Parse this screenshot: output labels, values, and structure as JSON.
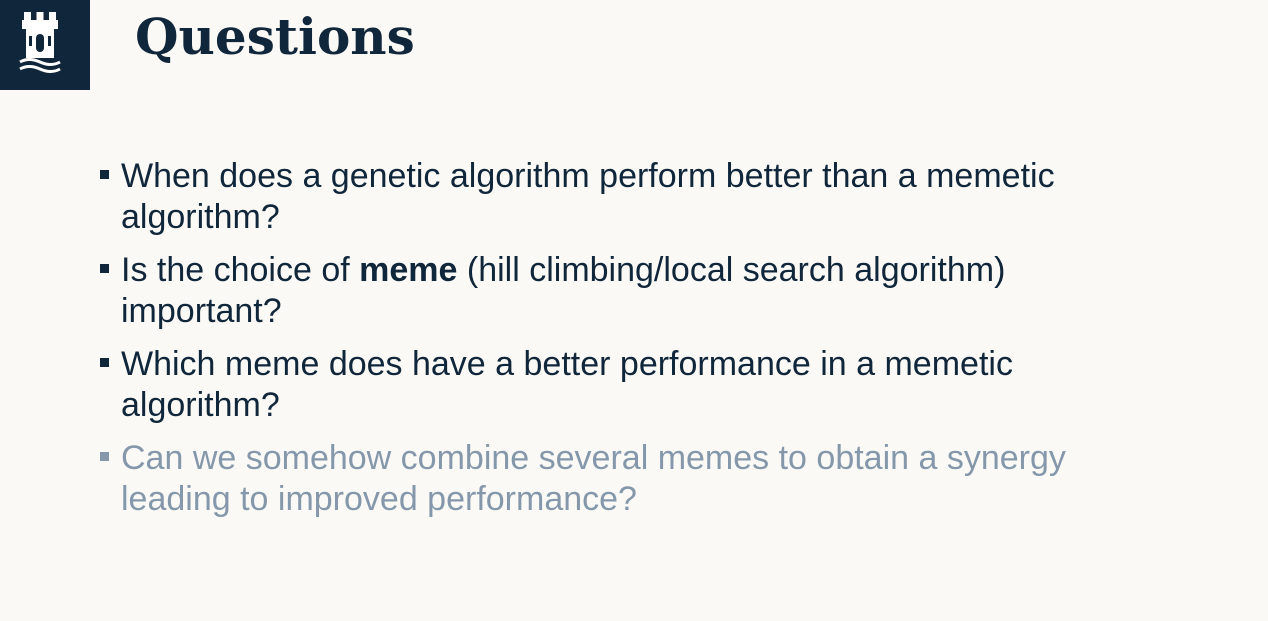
{
  "slide": {
    "title": "Questions",
    "logo_icon": "castle-tower-icon",
    "colors": {
      "brand_navy": "#10263b",
      "background": "#fbf9f5",
      "dimmed_text": "#8598ab"
    }
  },
  "bullets": [
    {
      "text": "When does a genetic algorithm perform better than a memetic algorithm?",
      "dimmed": false
    },
    {
      "before": "Is the choice of ",
      "bold": "meme",
      "after": " (hill climbing/local search algorithm) important?",
      "dimmed": false
    },
    {
      "text": "Which meme does have a better performance in a memetic algorithm?",
      "dimmed": false
    },
    {
      "text": "Can we somehow combine several memes to obtain a synergy leading to improved performance?",
      "dimmed": true
    }
  ]
}
